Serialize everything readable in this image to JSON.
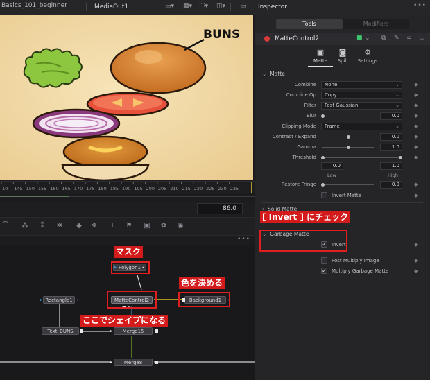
{
  "viewer": {
    "file_label": "Basics_101_beginner",
    "title": "MediaOut1",
    "buns_label": "BUNS",
    "ruler_ticks": [
      "10",
      "145",
      "150",
      "155",
      "160",
      "165",
      "170",
      "175",
      "180",
      "185",
      "190",
      "195",
      "200",
      "205",
      "210",
      "215",
      "220",
      "225",
      "230",
      "235"
    ],
    "current_frame": "86.0"
  },
  "flow": {
    "nodes": {
      "polygon": "Polygon1",
      "matte": "MatteControl2",
      "background": "Background1",
      "rectangle": "Rectangle1",
      "text_buns": "Text_BUNS",
      "merge15": "Merge15",
      "merge8": "Merge8"
    },
    "callouts": {
      "mask": "マスク",
      "color": "色を決める",
      "shape": "ここでシェイプになる",
      "invert": "[ Invert ] にチェック"
    }
  },
  "inspector": {
    "title": "Inspector",
    "seg_tools": "Tools",
    "seg_modifiers": "Modifiers",
    "node_name": "MatteControl2",
    "tabs": [
      {
        "label": "Matte",
        "icon": "matte-icon"
      },
      {
        "label": "Spill",
        "icon": "spill-icon"
      },
      {
        "label": "Settings",
        "icon": "settings-icon"
      }
    ],
    "matte_section": "Matte",
    "rows": {
      "combine": {
        "label": "Combine",
        "value": "None"
      },
      "combine_op": {
        "label": "Combine Op",
        "value": "Copy"
      },
      "filter": {
        "label": "Filter",
        "value": "Fast Gaussian"
      },
      "blur": {
        "label": "Blur",
        "value": "0.0"
      },
      "clipping_mode": {
        "label": "Clipping Mode",
        "value": "Frame"
      },
      "contract_expand": {
        "label": "Contract / Expand",
        "value": "0.0"
      },
      "gamma": {
        "label": "Gamma",
        "value": "1.0"
      },
      "threshold": {
        "label": "Threshold",
        "low_value": "0.0",
        "high_value": "1.0",
        "low_label": "Low",
        "high_label": "High"
      },
      "restore_fringe": {
        "label": "Restore Fringe",
        "value": "0.0"
      }
    },
    "invert_matte": "Invert Matte",
    "solid_matte": "Solid Matte",
    "garbage_matte": "Garbage Matte",
    "invert": "Invert",
    "post_multiply": "Post Multiply Image",
    "multiply_garbage": "Multiply Garbage Matte"
  }
}
